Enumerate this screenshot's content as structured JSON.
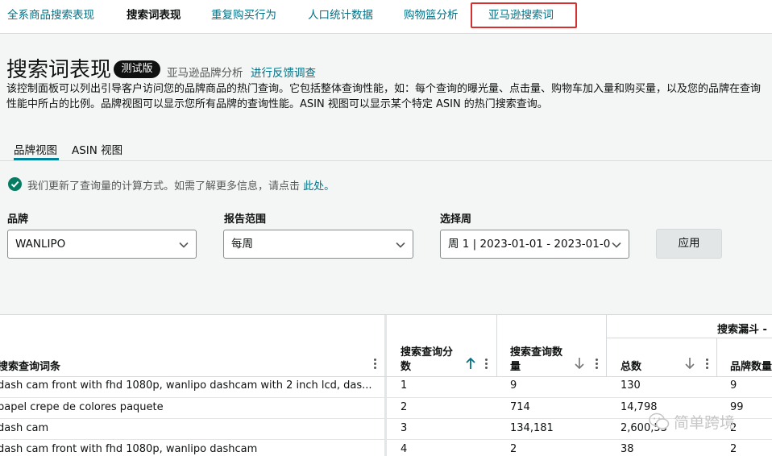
{
  "nav": {
    "tabs": [
      {
        "label": "全系商品搜索表现"
      },
      {
        "label": "搜索词表现"
      },
      {
        "label": "重复购买行为"
      },
      {
        "label": "人口统计数据"
      },
      {
        "label": "购物篮分析"
      },
      {
        "label": "亚马逊搜索词"
      }
    ]
  },
  "header": {
    "title": "搜索词表现",
    "badge": "测试版",
    "brand_analytics_link": "亚马逊品牌分析",
    "feedback_link": "进行反馈调查",
    "description": "该控制面板可以列出引导客户访问您的品牌商品的热门查询。它包括整体查询性能，如：每个查询的曝光量、点击量、购物车加入量和购买量，以及您的品牌在查询性能中所占的比例。品牌视图可以显示您所有品牌的查询性能。ASIN 视图可以显示某个特定 ASIN 的热门搜索查询。"
  },
  "view_tabs": [
    {
      "label": "品牌视图"
    },
    {
      "label": "ASIN 视图"
    }
  ],
  "notice": {
    "text": "我们更新了查询量的计算方式。如需了解更多信息，请点击",
    "link": "此处。"
  },
  "filters": {
    "brand_label": "品牌",
    "brand_value": "WANLIPO",
    "range_label": "报告范围",
    "range_value": "每周",
    "week_label": "选择周",
    "week_value": "周 1 | 2023-01-01 - 2023-01-0",
    "apply_label": "应用"
  },
  "table": {
    "group_header": "搜索漏斗 -",
    "columns": {
      "query": "搜索查询词条",
      "score_l1": "搜索查询分",
      "score_l2": "数",
      "volume_l1": "搜索查询数",
      "volume_l2": "量",
      "total": "总数",
      "brand_count": "品牌数量"
    },
    "rows": [
      {
        "query": "dash cam front with fhd 1080p, wanlipo dashcam with 2 inch lcd, das...",
        "score": "1",
        "volume": "9",
        "total": "130",
        "brand": "9"
      },
      {
        "query": "papel crepe de colores paquete",
        "score": "2",
        "volume": "714",
        "total": "14,798",
        "brand": "99"
      },
      {
        "query": "dash cam",
        "score": "3",
        "volume": "134,181",
        "total": "2,600,53",
        "brand": "2"
      },
      {
        "query": "dash cam front with fhd 1080p, wanlipo dashcam",
        "score": "4",
        "volume": "2",
        "total": "38",
        "brand": "2"
      }
    ]
  },
  "watermark": "简单跨境",
  "colors": {
    "link": "#007185",
    "highlight_box": "#d3302f",
    "tab_underline": "#008296",
    "success_icon": "#067d62"
  }
}
